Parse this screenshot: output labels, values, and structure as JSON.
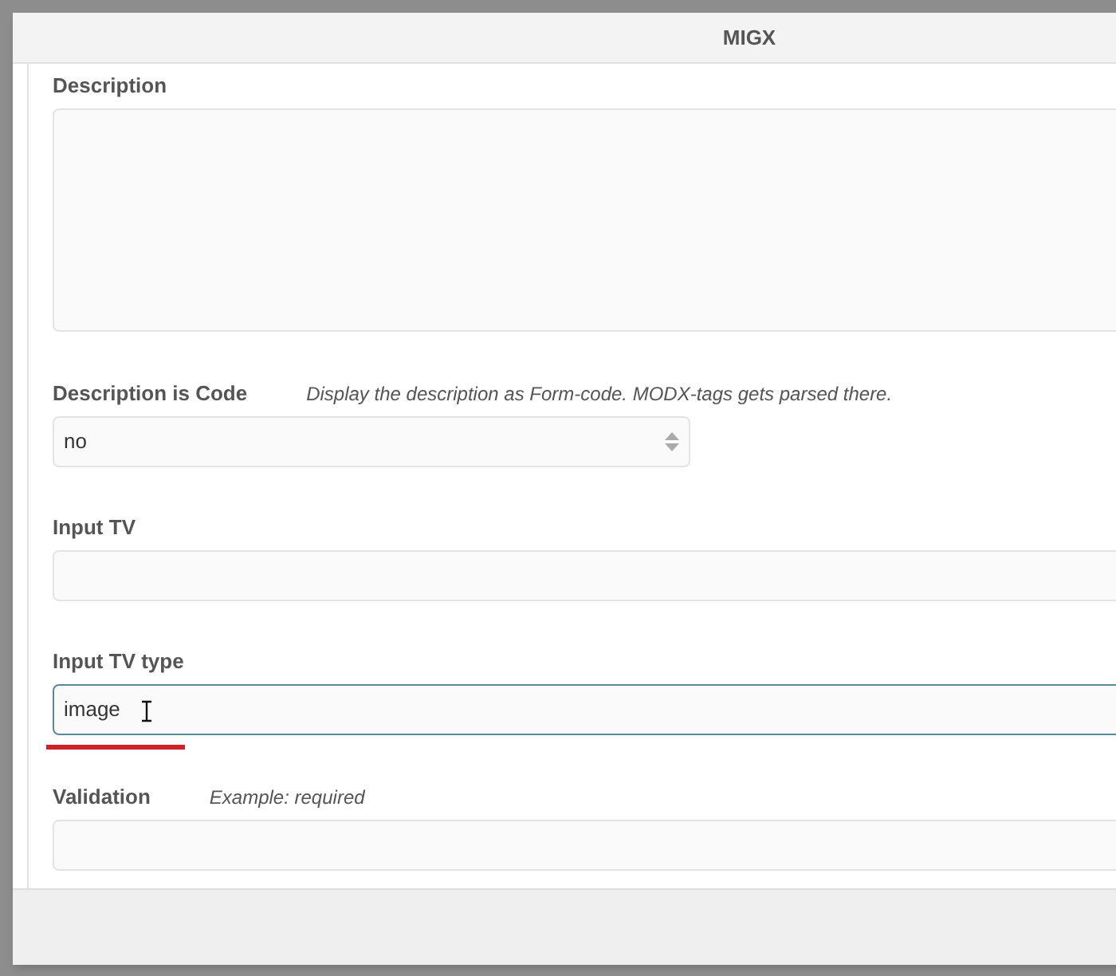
{
  "window": {
    "title": "MIGX"
  },
  "fields": [
    {
      "kind": "textarea",
      "label": "Description",
      "focused": false
    },
    {
      "kind": "select",
      "label": "Description is Code",
      "hint": "Display the description as Form-code. MODX-tags gets parsed there.",
      "value": "no",
      "focused": false
    },
    {
      "kind": "text",
      "label": "Input TV",
      "focused": false
    },
    {
      "kind": "text",
      "label": "Input TV type",
      "value": "image",
      "focused": true
    },
    {
      "kind": "text",
      "label": "Validation",
      "hint": "Example: required",
      "focused": false
    }
  ]
}
